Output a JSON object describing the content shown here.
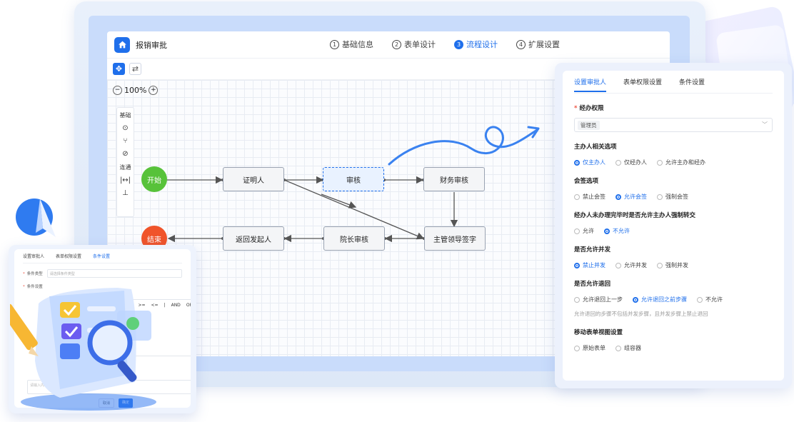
{
  "app": {
    "title": "报销审批",
    "steps": [
      {
        "num": "1",
        "label": "基础信息",
        "active": false
      },
      {
        "num": "2",
        "label": "表单设计",
        "active": false
      },
      {
        "num": "3",
        "label": "流程设计",
        "active": true
      },
      {
        "num": "4",
        "label": "扩展设置",
        "active": false
      }
    ],
    "zoom": "100%",
    "palette": {
      "basic": "基础",
      "connect": "连通"
    },
    "nodes": {
      "start": "开始",
      "certifier": "证明人",
      "review": "审核",
      "finance": "财务审核",
      "supervisor": "主管领导签字",
      "dean": "院长审核",
      "return": "返回发起人",
      "end": "结束"
    }
  },
  "right_panel": {
    "tabs": [
      "设置审批人",
      "表单权限设置",
      "条件设置"
    ],
    "handler_perm": {
      "title": "经办权限",
      "tag": "管理员"
    },
    "host_options": {
      "title": "主办人相关选项",
      "options": [
        "仅主办人",
        "仅经办人",
        "允许主办和经办"
      ],
      "selected": 0
    },
    "countersign": {
      "title": "会签选项",
      "options": [
        "禁止会签",
        "允许会签",
        "强制会签"
      ],
      "selected": 1
    },
    "force_transfer": {
      "title": "经办人未办理完毕时是否允许主办人强制转交",
      "options": [
        "允许",
        "不允许"
      ],
      "selected": 1
    },
    "parallel": {
      "title": "是否允许并发",
      "options": [
        "禁止并发",
        "允许并发",
        "强制并发"
      ],
      "selected": 0
    },
    "rollback": {
      "title": "是否允许退回",
      "options": [
        "允许退回上一步",
        "允许退回之前步骤",
        "不允许"
      ],
      "selected": 1,
      "hint": "允许退回的步骤不包括并发步骤，且并发步骤上禁止退回"
    },
    "mobile_view": {
      "title": "移动表单视图设置",
      "options": [
        "原始表单",
        "组容器"
      ],
      "selected": -1
    }
  },
  "left_panel": {
    "tabs": [
      "设置审批人",
      "表单权限设置",
      "条件设置"
    ],
    "cond_type_label": "条件类型",
    "cond_type_placeholder": "请选择条件类型",
    "cond_setting_label": "条件设置",
    "ops": [
      "!=",
      ">=",
      "<=",
      "|",
      "AND",
      "OR"
    ],
    "input_placeholder": "请输入内容",
    "cancel": "取消",
    "ok": "确定"
  }
}
